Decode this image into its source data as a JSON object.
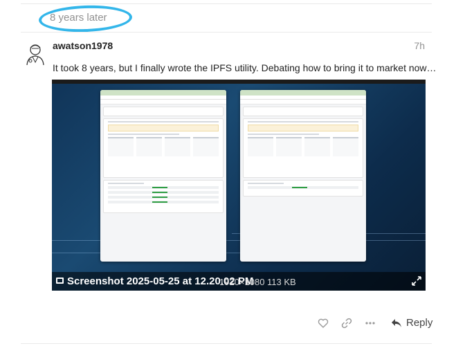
{
  "time_gap": {
    "label": "8 years later"
  },
  "post": {
    "username": "awatson1978",
    "date": "7h",
    "text": "It took 8 years, but I finally wrote the IPFS utility. Debating how to bring it to market now…",
    "avatar_icon": "doctor-avatar-icon"
  },
  "image": {
    "filename": "Screenshot 2025-05-25 at 12.20.02 PM",
    "meta": "1920×1080 113 KB",
    "caption_icon": "image-icon",
    "expand_icon": "expand-icon"
  },
  "actions": {
    "like_icon": "heart-icon",
    "link_icon": "link-icon",
    "more_icon": "more-icon",
    "reply_label": "Reply",
    "reply_icon": "reply-icon"
  },
  "colors": {
    "highlight_circle": "#33b6ea",
    "text_muted": "#919191",
    "caption_bg": "rgba(0,0,0,0.55)"
  }
}
